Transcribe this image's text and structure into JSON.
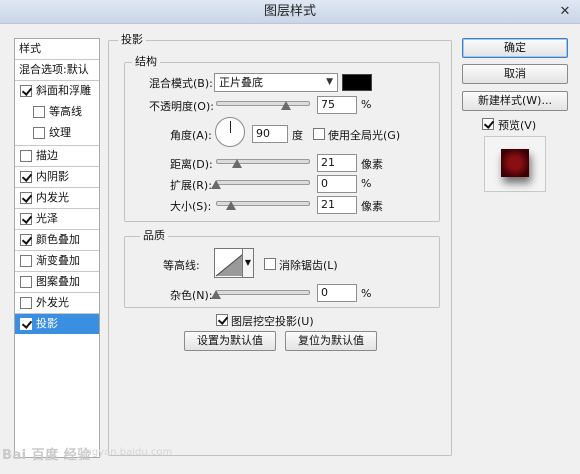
{
  "window": {
    "title": "图层样式",
    "close": "✕"
  },
  "stylelist": {
    "header": "样式",
    "blend_default": "混合选项:默认",
    "items": [
      {
        "label": "斜面和浮雕",
        "checked": true
      },
      {
        "label": "等高线",
        "checked": false
      },
      {
        "label": "纹理",
        "checked": false
      },
      {
        "label": "描边",
        "checked": false
      },
      {
        "label": "内阴影",
        "checked": true
      },
      {
        "label": "内发光",
        "checked": true
      },
      {
        "label": "光泽",
        "checked": true
      },
      {
        "label": "颜色叠加",
        "checked": true
      },
      {
        "label": "渐变叠加",
        "checked": false
      },
      {
        "label": "图案叠加",
        "checked": false
      },
      {
        "label": "外发光",
        "checked": false
      },
      {
        "label": "投影",
        "checked": true
      }
    ]
  },
  "shadow": {
    "title": "投影",
    "structure": {
      "title": "结构",
      "blend_mode_label": "混合模式(B):",
      "blend_mode_value": "正片叠底",
      "color": "#000000",
      "opacity_label": "不透明度(O):",
      "opacity_value": "75",
      "opacity_unit": "%",
      "opacity_level": 0.75,
      "angle_label": "角度(A):",
      "angle_value": "90",
      "angle_unit": "度",
      "global_light_label": "使用全局光(G)",
      "global_light_checked": false,
      "distance_label": "距离(D):",
      "distance_value": "21",
      "distance_unit": "像素",
      "spread_label": "扩展(R):",
      "spread_value": "0",
      "spread_unit": "%",
      "size_label": "大小(S):",
      "size_value": "21",
      "size_unit": "像素"
    },
    "quality": {
      "title": "品质",
      "contour_label": "等高线:",
      "antialias_label": "消除锯齿(L)",
      "antialias_checked": false,
      "noise_label": "杂色(N):",
      "noise_value": "0",
      "noise_unit": "%"
    },
    "knockout_label": "图层挖空投影(U)",
    "knockout_checked": true,
    "set_default_label": "设置为默认值",
    "reset_default_label": "复位为默认值"
  },
  "actions": {
    "ok": "确定",
    "cancel": "取消",
    "new_style": "新建样式(W)...",
    "preview_label": "预览(V)",
    "preview_checked": true
  },
  "watermark": {
    "text": "Bai 百度 经验",
    "url": "jingyan.baidu.com"
  }
}
